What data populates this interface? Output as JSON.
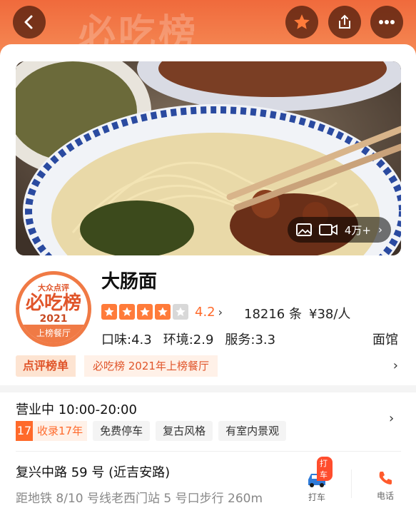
{
  "banner": {
    "watermark": "必吃榜"
  },
  "nav": {
    "back_icon": "chevron-left-icon",
    "favorite_icon": "star-icon",
    "share_icon": "share-icon",
    "more_icon": "more-icon"
  },
  "hero": {
    "media_count": "4万+"
  },
  "badge": {
    "top": "大众点评",
    "main": "必吃榜",
    "year": "2021",
    "strip": "上榜餐厅"
  },
  "shop": {
    "name": "大肠面",
    "stars": 4,
    "rating": "4.2",
    "reviews": "18216 条",
    "price": "¥38/人",
    "scores": [
      "口味:4.3",
      "环境:2.9",
      "服务:3.3"
    ],
    "category": "面馆"
  },
  "rank": {
    "tag": "点评榜单",
    "text": "必吃榜 2021年上榜餐厅"
  },
  "hours": {
    "text": "营业中 10:00-20:00"
  },
  "tags": {
    "years_num": "17",
    "years_label": "收录17年",
    "items": [
      "免费停车",
      "复古风格",
      "有室内景观"
    ]
  },
  "address": {
    "street": "复兴中路 59 号 (近吉安路)",
    "metro": "距地铁 8/10 号线老西门站 5 号口步行 260m"
  },
  "actions": {
    "taxi_badge": "打车",
    "taxi_label": "打车",
    "phone_label": "电话"
  },
  "colors": {
    "accent": "#ff6a2b",
    "banner": "#f06a3c"
  }
}
